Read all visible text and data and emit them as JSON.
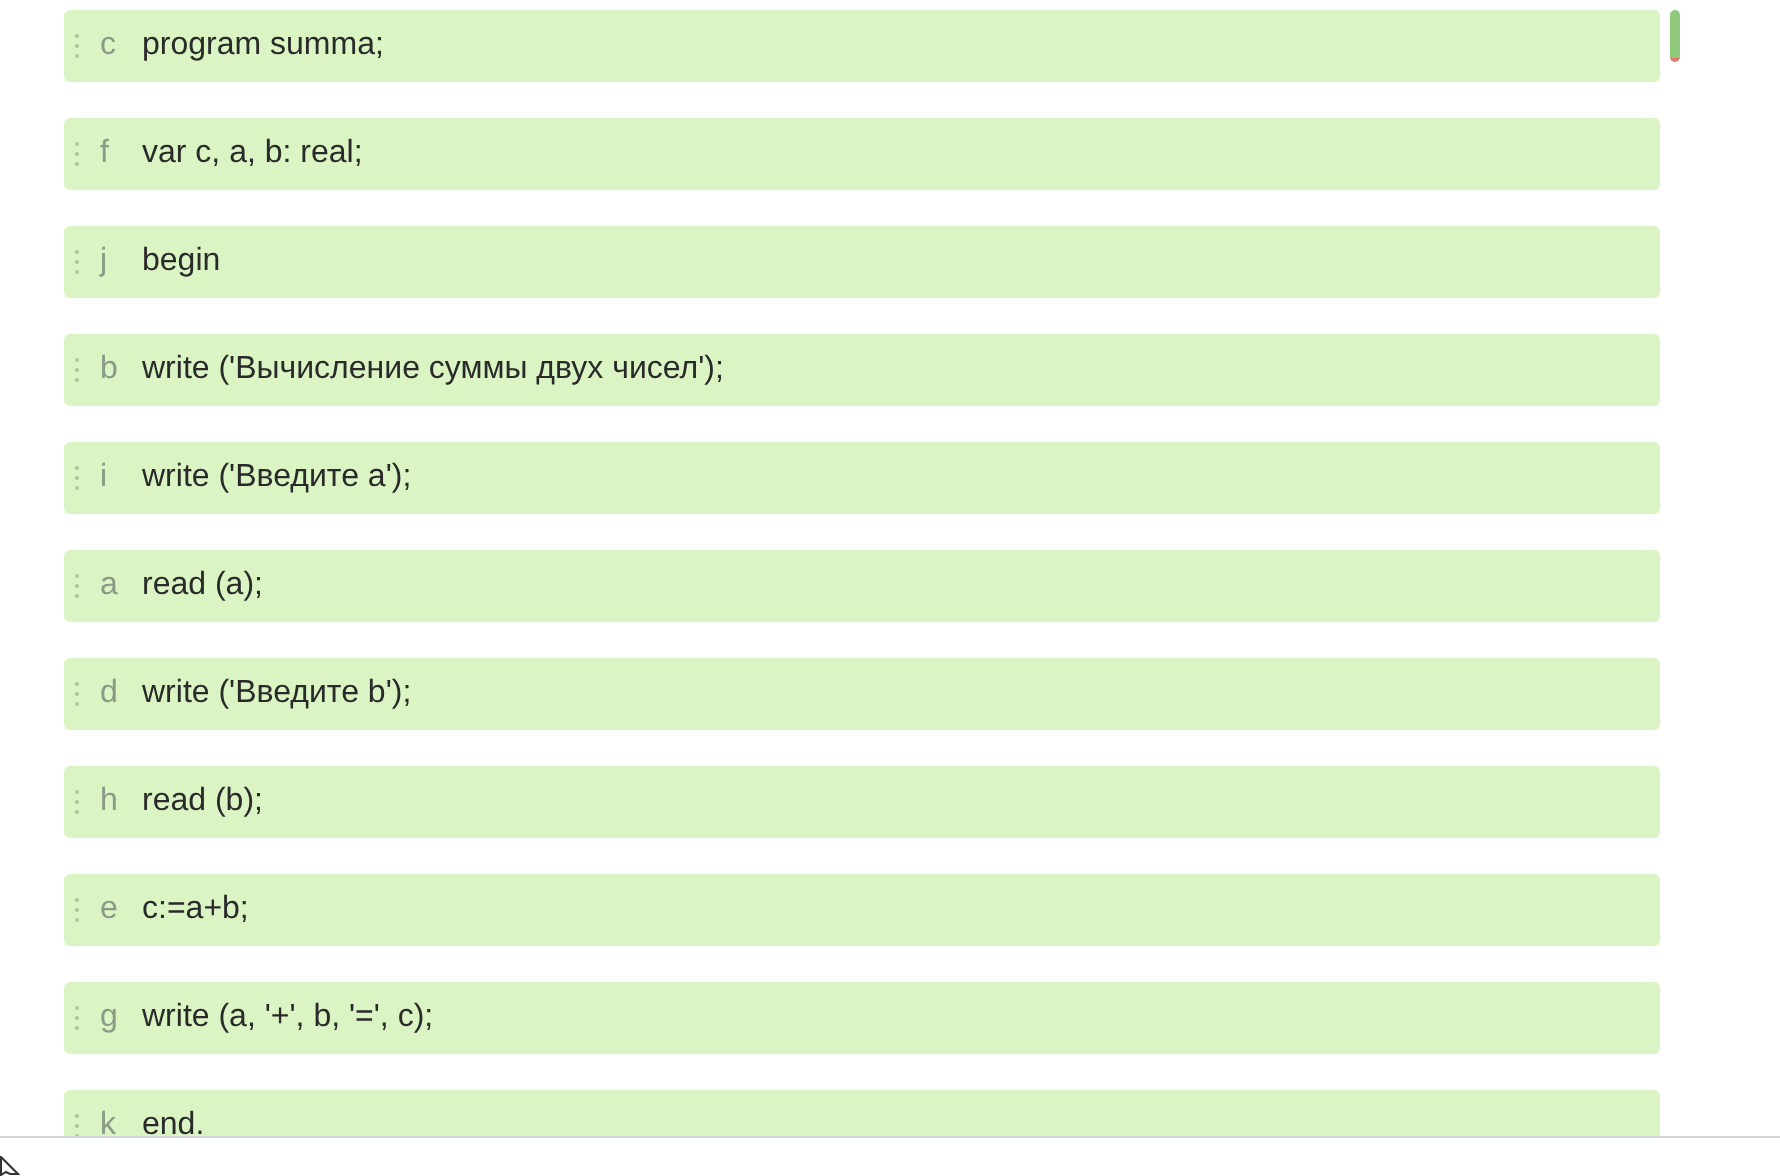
{
  "items": [
    {
      "letter": "c",
      "code": "program summa;"
    },
    {
      "letter": "f",
      "code": "var c, a, b: real;"
    },
    {
      "letter": "j",
      "code": "begin"
    },
    {
      "letter": "b",
      "code": "write ('Вычисление суммы двух чисел');"
    },
    {
      "letter": "i",
      "code": "write ('Введите a');"
    },
    {
      "letter": "a",
      "code": "read (a);"
    },
    {
      "letter": "d",
      "code": "write ('Введите b');"
    },
    {
      "letter": "h",
      "code": "read (b);"
    },
    {
      "letter": "e",
      "code": "c:=a+b;"
    },
    {
      "letter": "g",
      "code": "write (a, '+', b, '=', c);"
    },
    {
      "letter": "k",
      "code": "end."
    }
  ]
}
